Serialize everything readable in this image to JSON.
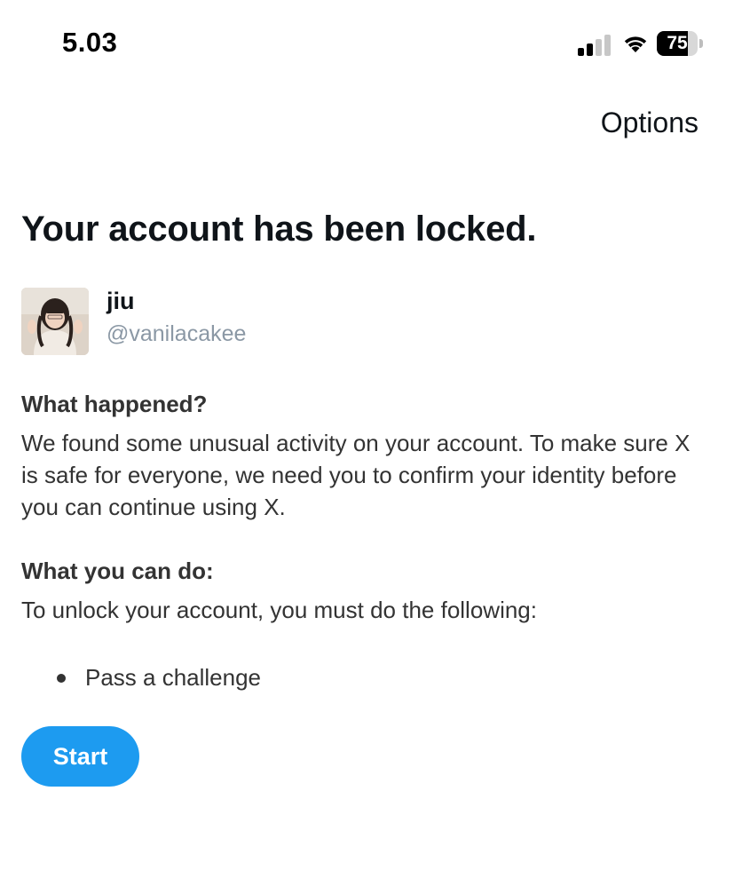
{
  "status_bar": {
    "time": "5.03",
    "battery_level": "75",
    "battery_fraction": 0.75,
    "signal_bars_active": 2,
    "signal_bars_total": 4
  },
  "header": {
    "options_label": "Options"
  },
  "title": "Your account has been locked.",
  "account": {
    "display_name": "jiu",
    "handle": "@vanilacakee"
  },
  "what_happened": {
    "heading": "What happened?",
    "body": "We found some unusual activity on your account. To make sure X is safe for everyone, we need you to confirm your identity before you can continue using X."
  },
  "what_you_can_do": {
    "heading": "What you can do:",
    "body": "To unlock your account, you must do the following:",
    "steps": [
      "Pass a challenge"
    ]
  },
  "actions": {
    "start_label": "Start"
  },
  "colors": {
    "accent": "#1d9bf0",
    "text_primary": "#0f1419",
    "text_secondary": "#8b98a5",
    "body_text": "#333333"
  },
  "icons": {
    "signal": "cellular-signal-icon",
    "wifi": "wifi-icon",
    "battery": "battery-icon"
  }
}
